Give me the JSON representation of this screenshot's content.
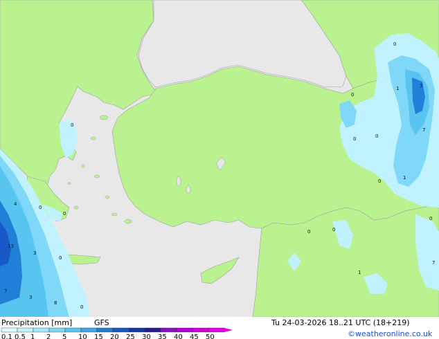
{
  "title": "Precipitation [mm]",
  "model": "GFS",
  "valid_time": "Tu 24-03-2026 18..21 UTC (18+219)",
  "credit": "©weatheronline.co.uk",
  "legend": {
    "labels": [
      "0.1",
      "0.5",
      "1",
      "2",
      "5",
      "10",
      "15",
      "20",
      "25",
      "30",
      "35",
      "40",
      "45",
      "50"
    ],
    "colors": [
      "#e0fbff",
      "#c0f2ff",
      "#a0e8ff",
      "#80d8f8",
      "#58c4f0",
      "#38a8e8",
      "#2080d8",
      "#1858c8",
      "#103aa8",
      "#2a1a98",
      "#8a10c8",
      "#b000d8",
      "#d000d8",
      "#e000e0"
    ]
  },
  "colors": {
    "sea": "#e8e8e8",
    "land": "#b9f28e",
    "border": "#a0a0a0"
  },
  "values": [
    "0",
    "1",
    "3",
    "7",
    "0",
    "0",
    "0",
    "0",
    "1",
    "0",
    "4",
    "0",
    "0",
    "13",
    "3",
    "0",
    "7",
    "3",
    "8",
    "0",
    "0",
    "0",
    "0",
    "1",
    "7"
  ]
}
